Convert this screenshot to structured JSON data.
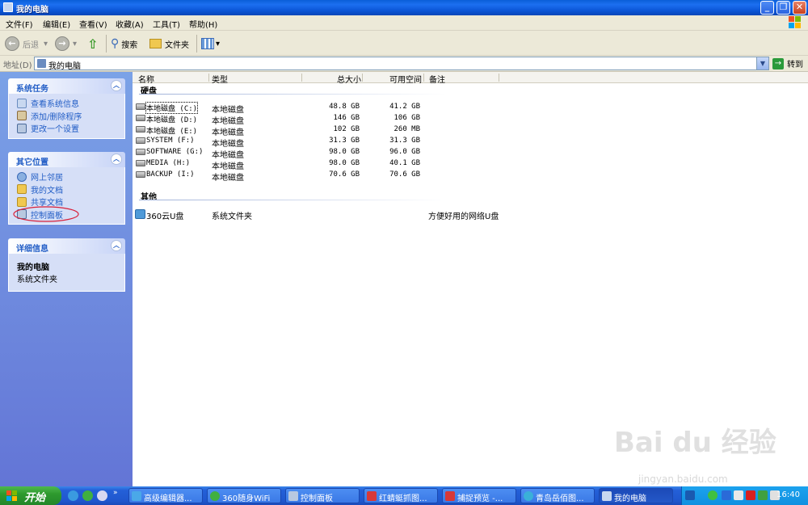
{
  "window": {
    "title": "我的电脑"
  },
  "menu": [
    "文件(F)",
    "编辑(E)",
    "查看(V)",
    "收藏(A)",
    "工具(T)",
    "帮助(H)"
  ],
  "toolbar": {
    "back": "后退",
    "search": "搜索",
    "folders": "文件夹"
  },
  "address": {
    "label": "地址(D)",
    "value": "我的电脑",
    "go": "转到"
  },
  "left": {
    "system_tasks": {
      "title": "系统任务",
      "items": [
        "查看系统信息",
        "添加/删除程序",
        "更改一个设置"
      ]
    },
    "other_places": {
      "title": "其它位置",
      "items": [
        "网上邻居",
        "我的文档",
        "共享文档",
        "控制面板"
      ]
    },
    "details": {
      "title": "详细信息",
      "name": "我的电脑",
      "type": "系统文件夹"
    }
  },
  "columns": [
    "名称",
    "类型",
    "总大小",
    "可用空间",
    "备注"
  ],
  "groups": {
    "hard_disks": "硬盘",
    "other": "其他"
  },
  "drives": [
    {
      "name": "本地磁盘 (C:)",
      "type": "本地磁盘",
      "total": "48.8 GB",
      "free": "41.2 GB"
    },
    {
      "name": "本地磁盘 (D:)",
      "type": "本地磁盘",
      "total": "146 GB",
      "free": "106 GB"
    },
    {
      "name": "本地磁盘 (E:)",
      "type": "本地磁盘",
      "total": "102 GB",
      "free": "260 MB"
    },
    {
      "name": "SYSTEM (F:)",
      "type": "本地磁盘",
      "total": "31.3 GB",
      "free": "31.3 GB"
    },
    {
      "name": "SOFTWARE (G:)",
      "type": "本地磁盘",
      "total": "98.0 GB",
      "free": "96.0 GB"
    },
    {
      "name": "MEDIA (H:)",
      "type": "本地磁盘",
      "total": "98.0 GB",
      "free": "40.1 GB"
    },
    {
      "name": "BACKUP (I:)",
      "type": "本地磁盘",
      "total": "70.6 GB",
      "free": "70.6 GB"
    }
  ],
  "other_items": [
    {
      "name": "360云U盘",
      "type": "系统文件夹",
      "note": "方便好用的网络U盘"
    }
  ],
  "taskbar": {
    "start": "开始",
    "tasks": [
      "高级编辑器...",
      "360随身WiFi",
      "控制面板",
      "红蜻蜓抓图...",
      "捕捉预览 -...",
      "青岛岳佰图...",
      "我的电脑"
    ],
    "clock": "16:40"
  },
  "watermark": {
    "main": "Bai du 经验",
    "sub": "jingyan.baidu.com"
  }
}
